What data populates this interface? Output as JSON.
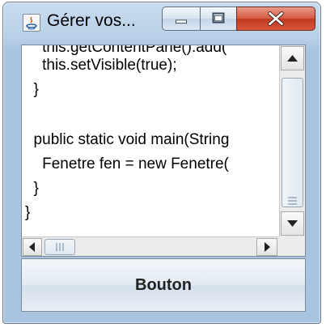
{
  "window": {
    "title": "Gérer vos...",
    "controls": {
      "minimize": "minimize",
      "maximize": "maximize",
      "close": "close"
    }
  },
  "editor": {
    "lines": [
      "    this.getContentPane().add(",
      "    this.setVisible(true);",
      "  }",
      "",
      "  public static void main(String",
      "    Fenetre fen = new Fenetre(",
      "  }",
      "}"
    ]
  },
  "button": {
    "label": "Bouton"
  },
  "icons": {
    "app": "java-icon",
    "minimize": "minimize-icon",
    "maximize": "maximize-icon",
    "close": "close-icon"
  },
  "colors": {
    "close_red": "#c0391f",
    "title_bg": "#b7cfe7"
  }
}
